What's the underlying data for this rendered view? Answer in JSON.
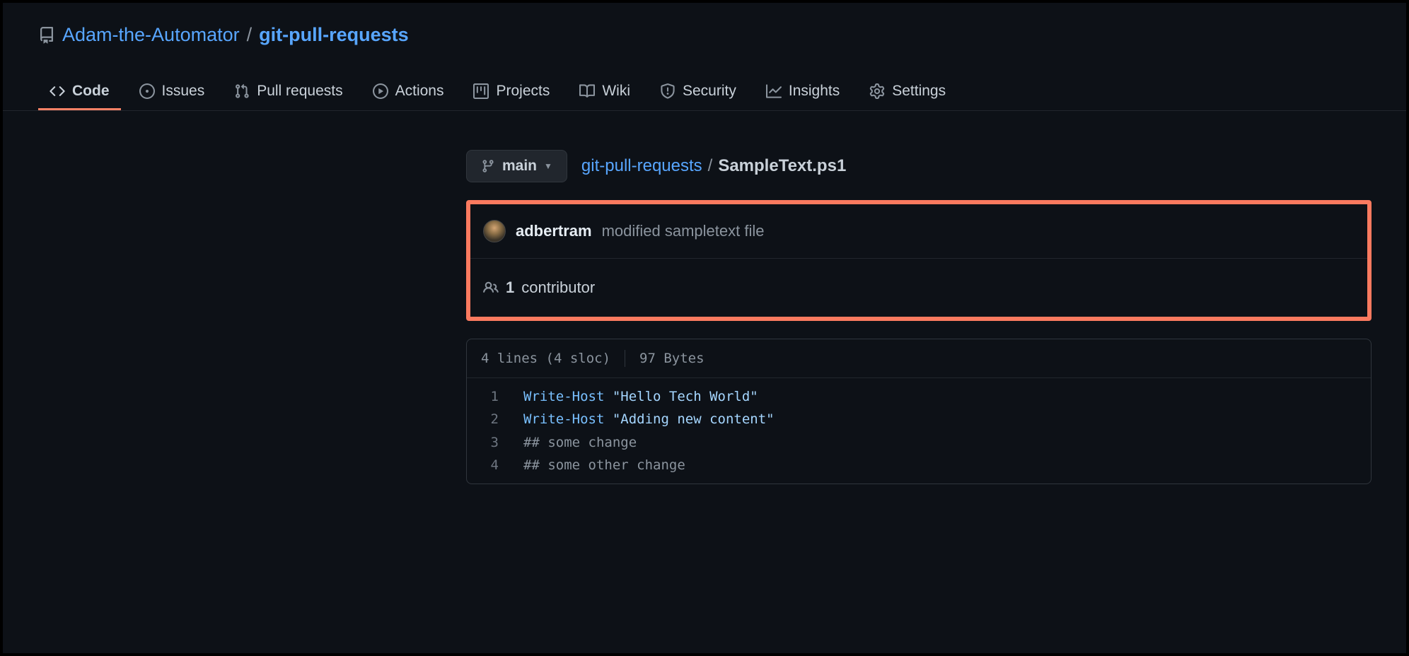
{
  "header": {
    "owner": "Adam-the-Automator",
    "repo": "git-pull-requests",
    "separator": "/"
  },
  "tabs": {
    "code": "Code",
    "issues": "Issues",
    "pull_requests": "Pull requests",
    "actions": "Actions",
    "projects": "Projects",
    "wiki": "Wiki",
    "security": "Security",
    "insights": "Insights",
    "settings": "Settings"
  },
  "branch": {
    "name": "main"
  },
  "breadcrumb": {
    "repo": "git-pull-requests",
    "separator": "/",
    "filename": "SampleText.ps1"
  },
  "commit": {
    "author": "adbertram",
    "message": "modified sampletext file"
  },
  "contributors": {
    "count": "1",
    "label": "contributor"
  },
  "code_meta": {
    "lines": "4 lines (4 sloc)",
    "size": "97 Bytes"
  },
  "code": {
    "lines": [
      {
        "num": "1",
        "cmdlet": "Write-Host",
        "string": "\"Hello Tech World\""
      },
      {
        "num": "2",
        "cmdlet": "Write-Host",
        "string": "\"Adding new content\""
      },
      {
        "num": "3",
        "comment": "## some change"
      },
      {
        "num": "4",
        "comment": "## some other change"
      }
    ]
  }
}
